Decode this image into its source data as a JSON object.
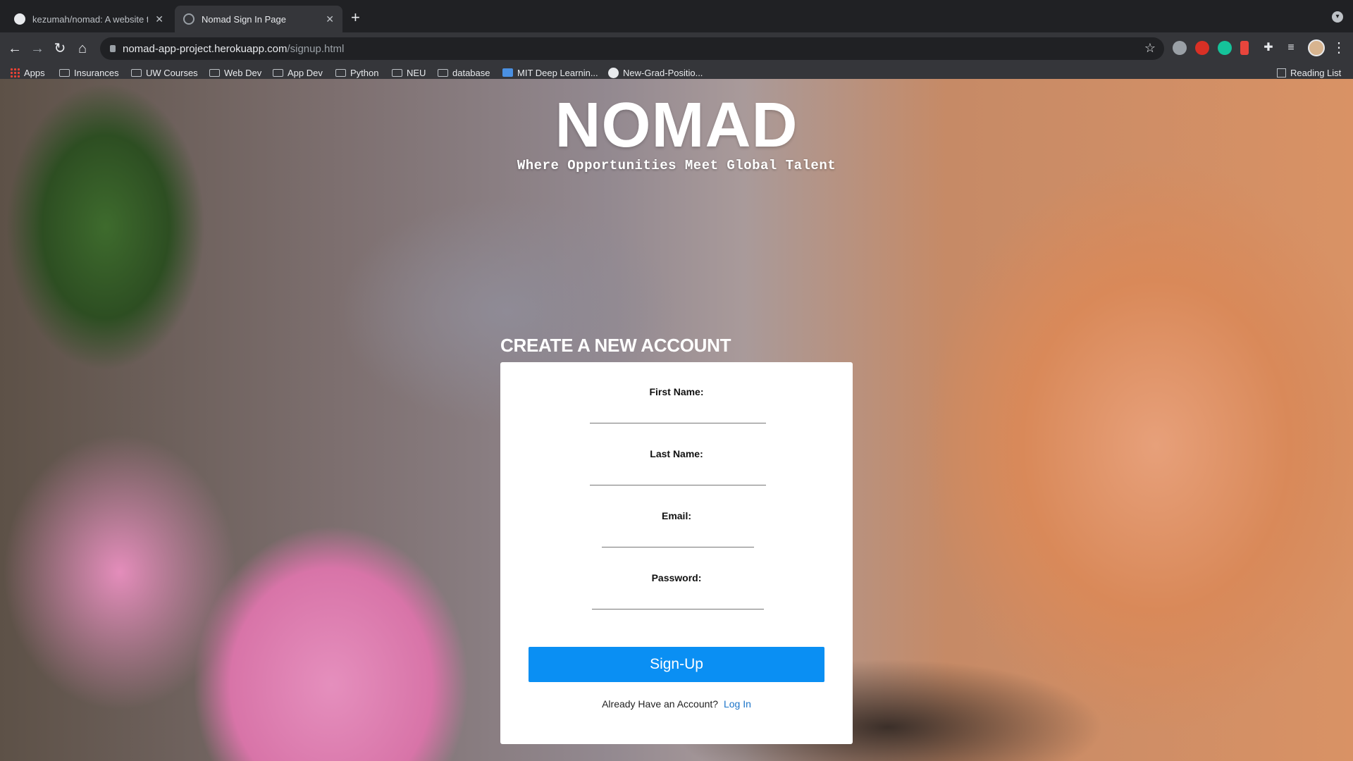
{
  "browser": {
    "tabs": [
      {
        "title": "kezumah/nomad: A website to",
        "active": false,
        "icon": "github-icon"
      },
      {
        "title": "Nomad Sign In Page",
        "active": true,
        "icon": "globe-icon"
      }
    ],
    "url_host": "nomad-app-project.herokuapp.com",
    "url_path": "/signup.html",
    "bookmarks": [
      {
        "label": "Apps",
        "icon": "apps-grid-icon"
      },
      {
        "label": "Insurances",
        "icon": "folder-icon"
      },
      {
        "label": "UW Courses",
        "icon": "folder-icon"
      },
      {
        "label": "Web Dev",
        "icon": "folder-icon"
      },
      {
        "label": "App Dev",
        "icon": "folder-icon"
      },
      {
        "label": "Python",
        "icon": "folder-icon"
      },
      {
        "label": "NEU",
        "icon": "folder-icon"
      },
      {
        "label": "database",
        "icon": "folder-icon"
      },
      {
        "label": "MIT Deep Learnin...",
        "icon": "mit-icon"
      },
      {
        "label": "New-Grad-Positio...",
        "icon": "github-icon"
      }
    ],
    "reading_list": "Reading List"
  },
  "page": {
    "logo": "NOMAD",
    "tagline": "Where Opportunities Meet Global Talent",
    "form_heading": "CREATE A NEW ACCOUNT",
    "fields": {
      "first_name": {
        "label": "First Name:",
        "value": ""
      },
      "last_name": {
        "label": "Last Name:",
        "value": ""
      },
      "email": {
        "label": "Email:",
        "value": ""
      },
      "password": {
        "label": "Password:",
        "value": ""
      }
    },
    "signup_button": "Sign-Up",
    "login_prompt": "Already Have an Account?",
    "login_link": "Log In"
  },
  "colors": {
    "button_blue": "#0a8ff3",
    "link_blue": "#1a73c8",
    "chrome_dark": "#202124",
    "toolbar": "#35363a"
  }
}
